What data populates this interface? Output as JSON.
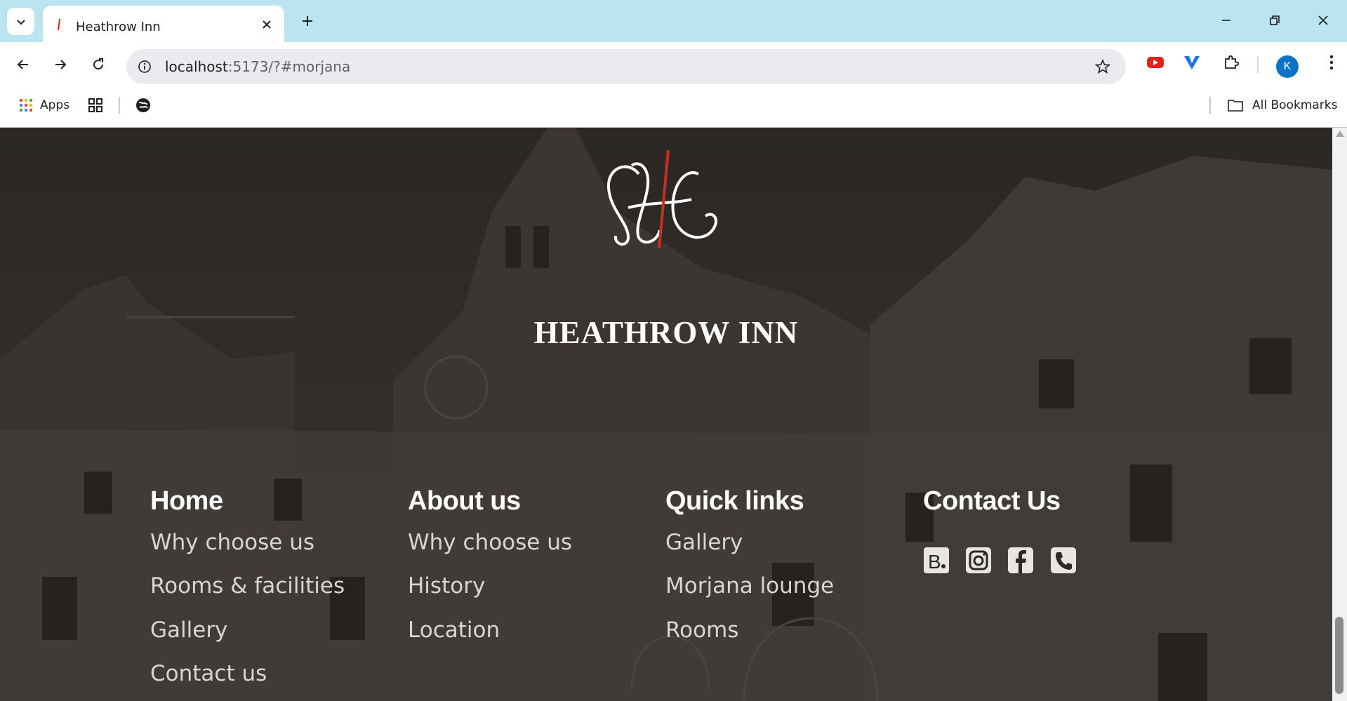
{
  "browser": {
    "tab_title": "Heathrow Inn",
    "url_host": "localhost",
    "url_rest": ":5173/?#morjana",
    "bookmarks": {
      "apps_label": "Apps",
      "all_bookmarks_label": "All Bookmarks"
    },
    "profile_initial": "K"
  },
  "site": {
    "brand_name": "HEATHROW INN",
    "logo_letters": "HI",
    "accent_color": "#c4321f"
  },
  "footer": {
    "columns": [
      {
        "heading": "Home",
        "links": [
          "Why choose us",
          "Rooms & facilities",
          "Gallery",
          "Contact us"
        ]
      },
      {
        "heading": "About us",
        "links": [
          "Why choose us",
          "History",
          "Location"
        ]
      },
      {
        "heading": "Quick links",
        "links": [
          "Gallery",
          "Morjana lounge",
          "Rooms"
        ]
      },
      {
        "heading": "Contact Us",
        "links": []
      }
    ],
    "social_icons": [
      "booking-icon",
      "instagram-icon",
      "facebook-icon",
      "phone-icon"
    ]
  }
}
